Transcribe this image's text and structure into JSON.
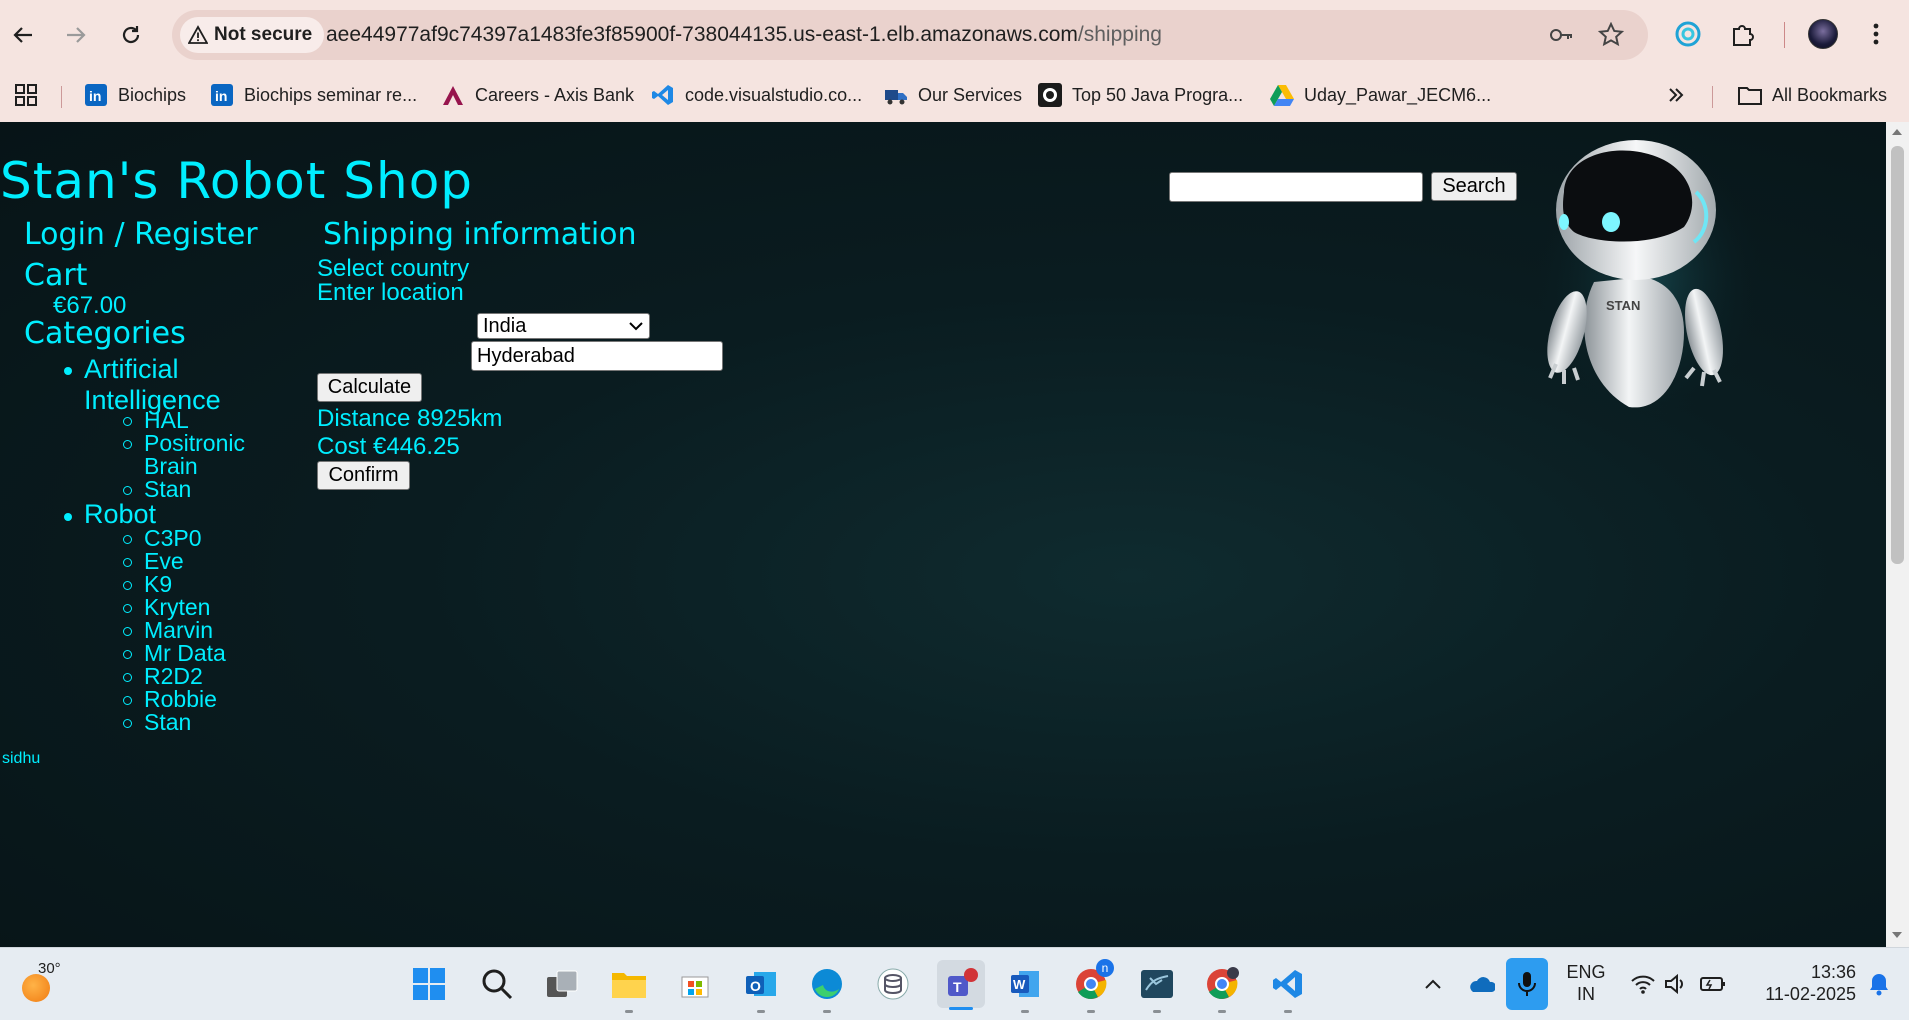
{
  "browser": {
    "security_label": "Not secure",
    "url_host": "aee44977af9c74397a1483fe3f85900f-738044135.us-east-1.elb.amazonaws.com",
    "url_path": "/shipping"
  },
  "bookmarks": {
    "items": [
      {
        "label": "Biochips",
        "icon": "linkedin-icon"
      },
      {
        "label": "Biochips seminar re...",
        "icon": "linkedin-icon"
      },
      {
        "label": "Careers - Axis Bank",
        "icon": "axis-bank-icon"
      },
      {
        "label": "code.visualstudio.co...",
        "icon": "vscode-icon"
      },
      {
        "label": "Our Services",
        "icon": "truck-icon"
      },
      {
        "label": "Top 50 Java Progra...",
        "icon": "java-site-icon"
      },
      {
        "label": "Uday_Pawar_JECM6...",
        "icon": "google-drive-icon"
      }
    ],
    "all_bookmarks_label": "All Bookmarks"
  },
  "shop": {
    "title": "Stan's Robot Shop",
    "search_button": "Search",
    "search_value": ""
  },
  "sidebar": {
    "login_register": "Login / Register",
    "cart_heading": "Cart",
    "cart_total": "€67.00",
    "categories_heading": "Categories",
    "categories": [
      {
        "name_line1": "Artificial",
        "name_line2": "Intelligence",
        "products": [
          "HAL",
          "Positronic",
          "Brain",
          "Stan"
        ]
      },
      {
        "name_line1": "Robot",
        "products": [
          "C3P0",
          "Eve",
          "K9",
          "Kryten",
          "Marvin",
          "Mr Data",
          "R2D2",
          "Robbie",
          "Stan"
        ]
      }
    ]
  },
  "shipping": {
    "heading": "Shipping information",
    "country_label": "Select country",
    "country_value": "India",
    "location_label": "Enter location",
    "location_value": "Hyderabad",
    "calculate_button": "Calculate",
    "distance_text": "Distance 8925km",
    "cost_text": "Cost €446.25",
    "confirm_button": "Confirm"
  },
  "robot_image": {
    "label": "STAN"
  },
  "footer": {
    "user": "sidhu"
  },
  "taskbar": {
    "weather_temp": "30°",
    "language_line1": "ENG",
    "language_line2": "IN",
    "time": "13:36",
    "date": "11-02-2025",
    "chrome_badge": "n"
  },
  "colors": {
    "accent": "#00eeff",
    "page_background": "#0a1c20",
    "browser_chrome": "#f5e4e0"
  }
}
